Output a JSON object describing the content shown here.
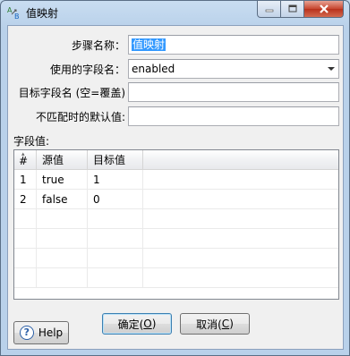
{
  "window": {
    "title": "值映射"
  },
  "form": {
    "step_name_label": "步骤名称：",
    "step_name_value": "值映射",
    "field_label": "使用的字段名：",
    "field_value": "enabled",
    "target_label": "目标字段名 (空=覆盖)",
    "target_value": "",
    "default_label": "不匹配时的默认值:",
    "default_value": ""
  },
  "grid": {
    "section_label": "字段值:",
    "columns": [
      "#",
      "源值",
      "目标值"
    ],
    "rows": [
      {
        "num": "1",
        "source": "true",
        "target": "1"
      },
      {
        "num": "2",
        "source": "false",
        "target": "0"
      }
    ]
  },
  "buttons": {
    "ok_label": "确定(",
    "ok_key": "O",
    "ok_suffix": ")",
    "cancel_label": "取消(",
    "cancel_key": "C",
    "cancel_suffix": ")",
    "help_label": "Help"
  }
}
